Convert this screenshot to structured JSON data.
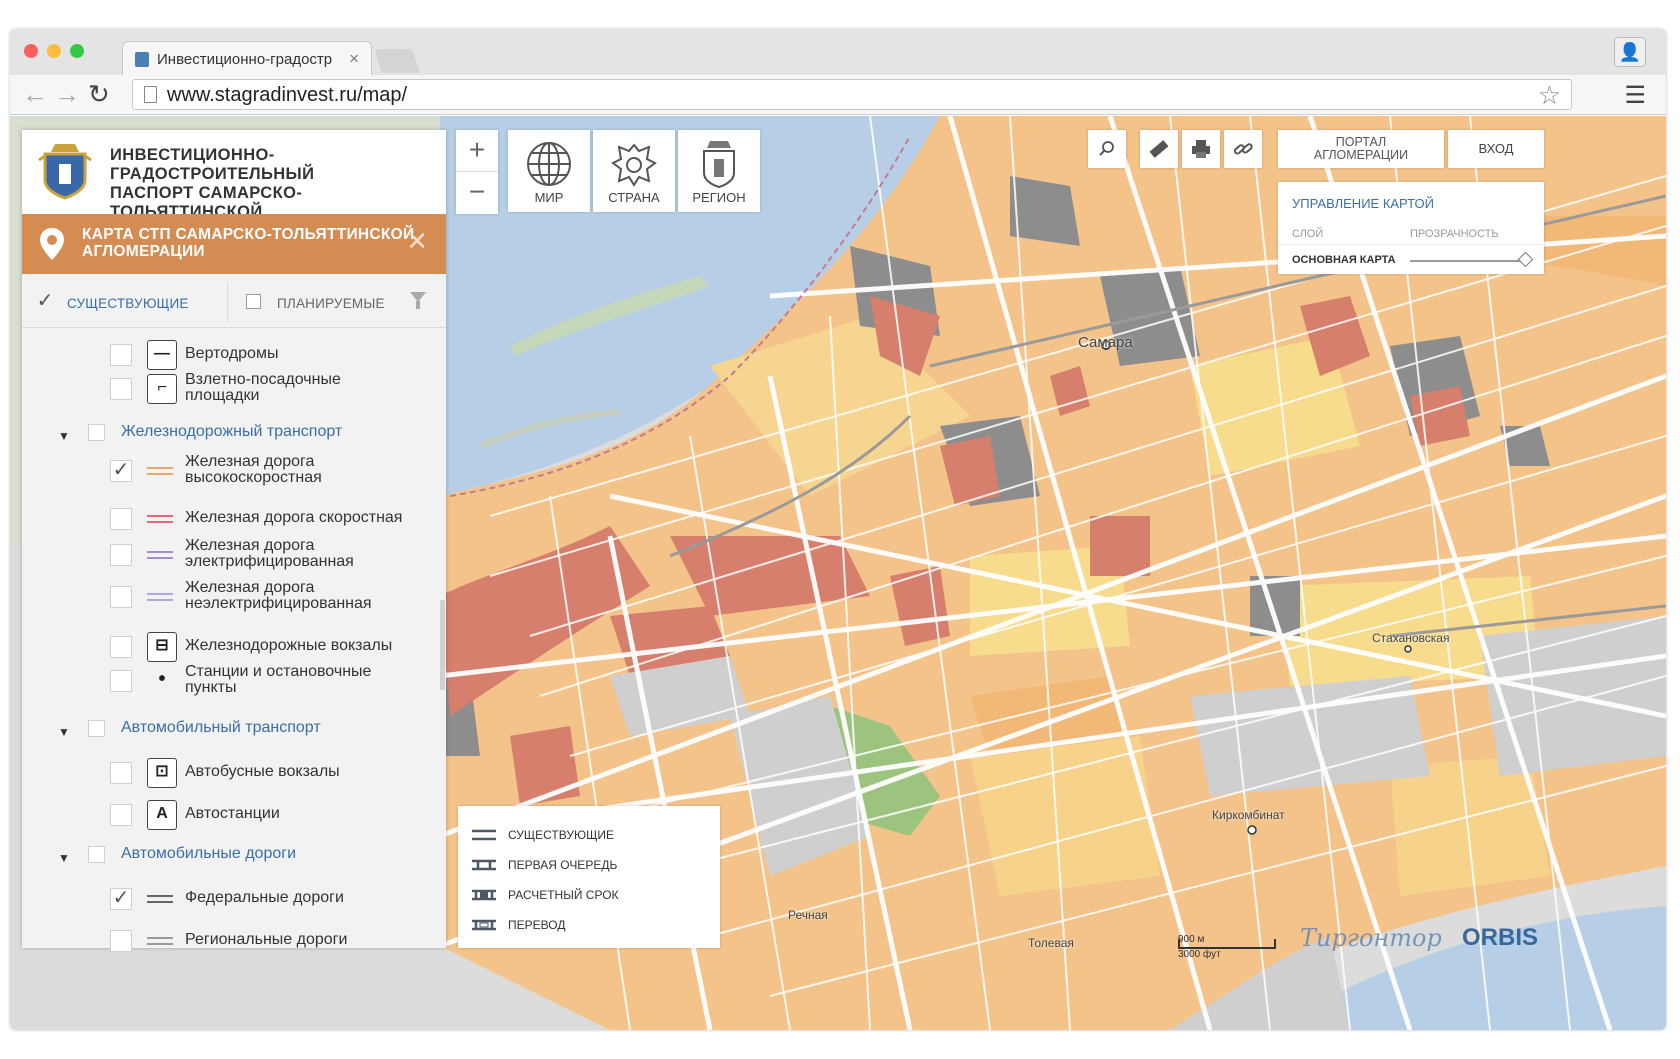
{
  "browser": {
    "tab_title": "Инвестиционно-градостр",
    "url": "www.stagradinvest.ru/map/"
  },
  "panel": {
    "title": "ИНВЕСТИЦИОННО-ГРАДОСТРОИТЕЛЬНЫЙ\nПАСПОРТ САМАРСКО-ТОЛЬЯТТИНСКОЙ\nАГЛОМЕРАЦИИ",
    "map_title": "КАРТА СТП САМАРСКО-ТОЛЬЯТТИНСКОЙ\nАГЛОМЕРАЦИИ",
    "filter_existing": "СУЩЕСТВУЮЩИЕ",
    "filter_planned": "ПЛАНИРУЕМЫЕ",
    "layers": [
      {
        "label": "Вертодромы",
        "checked": false,
        "icon": "helipad-icon",
        "glyph": "—"
      },
      {
        "label": "Взлетно-посадочные\nплощадки",
        "checked": false,
        "icon": "runway-icon",
        "glyph": "⌐"
      },
      {
        "group": true,
        "label": "Железнодорожный транспорт",
        "checked": false
      },
      {
        "label": "Железная дорога\nвысокоскоростная",
        "checked": true,
        "swatch": "#e9a76a"
      },
      {
        "label": "Железная дорога скоростная",
        "checked": false,
        "swatch": "#e46a78"
      },
      {
        "label": "Железная дорога\nэлектрифицированная",
        "checked": false,
        "swatch": "#a58fd0"
      },
      {
        "label": "Железная дорога\nнеэлектрифицированная",
        "checked": false,
        "swatch": "#b5a8e0"
      },
      {
        "label": "Железнодорожные вокзалы",
        "checked": false,
        "icon": "train-icon",
        "glyph": "⊟"
      },
      {
        "label": "Станции и остановочные\nпункты",
        "checked": false,
        "icon": "station-dot-icon",
        "glyph": "•"
      },
      {
        "group": true,
        "label": "Автомобильный транспорт",
        "checked": false
      },
      {
        "label": "Автобусные вокзалы",
        "checked": false,
        "icon": "bus-icon",
        "glyph": "⊡"
      },
      {
        "label": "Автостанции",
        "checked": false,
        "icon": "bus-station-icon",
        "glyph": "A"
      },
      {
        "group": true,
        "label": "Автомобильные дороги",
        "checked": false
      },
      {
        "label": "Федеральные дороги",
        "checked": true,
        "swatch": "#666"
      },
      {
        "label": "Региональные дороги",
        "checked": false,
        "swatch": "#999"
      }
    ]
  },
  "scopes": [
    {
      "label": "МИР",
      "icon": "globe-icon"
    },
    {
      "label": "СТРАНА",
      "icon": "russia-emblem-icon"
    },
    {
      "label": "РЕГИОН",
      "icon": "region-emblem-icon"
    }
  ],
  "top_right": {
    "portal": "ПОРТАЛ\nАГЛОМЕРАЦИИ",
    "login": "ВХОД"
  },
  "map_control": {
    "title": "УПРАВЛЕНИЕ КАРТОЙ",
    "col_layer": "СЛОЙ",
    "col_opacity": "ПРОЗРАЧНОСТЬ",
    "layer_name": "ОСНОВНАЯ КАРТА",
    "opacity": 1.0
  },
  "legend": [
    {
      "label": "СУЩЕСТВУЮЩИЕ"
    },
    {
      "label": "ПЕРВАЯ ОЧЕРЕДЬ"
    },
    {
      "label": "РАСЧЕТНЫЙ СРОК"
    },
    {
      "label": "ПЕРЕВОД"
    }
  ],
  "map_labels": {
    "city": "Самара",
    "stakhanovskaya": "Стахановская",
    "kirkombinat": "Киркомбинат",
    "rechnaya": "Речная",
    "toleva": "Толевая"
  },
  "scale": {
    "metric": "900 м",
    "imperial": "3000 фут"
  },
  "brands": {
    "left": "Тиргонтор",
    "right": "ORBIS"
  },
  "colors": {
    "accent": "#d58c53",
    "link": "#3b6ea6",
    "water": "#b7cfe6",
    "residential": "#f3c38a",
    "commercial": "#d57f6c",
    "industrial": "#8d8d8d",
    "park": "#9dc47f"
  }
}
